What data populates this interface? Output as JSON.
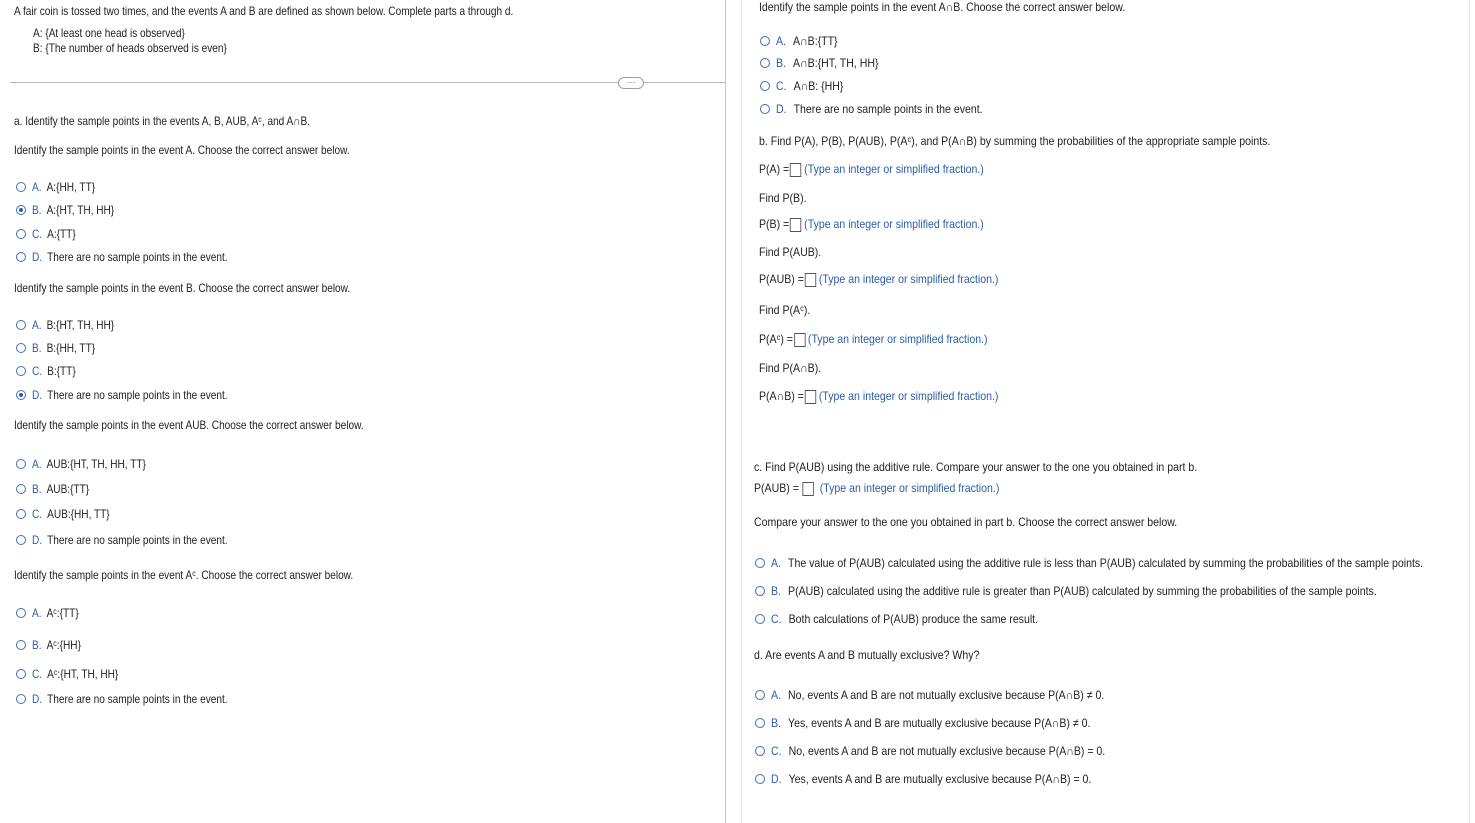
{
  "intro": {
    "text": "A fair coin is tossed two times, and the events A and B are defined as shown below. Complete parts a through d.",
    "event_a": "A: {At least one head is observed}",
    "event_b": "B: {The number of heads observed is even}"
  },
  "divider_handle": "⋯",
  "part_a": {
    "heading": "a. Identify the sample points in the events A, B, AUB, Aᶜ, and A∩B.",
    "q_a": {
      "prompt": "Identify the sample points in the event A. Choose the correct answer below.",
      "options": [
        {
          "letter": "A.",
          "text": "A:{HH, TT}",
          "selected": false
        },
        {
          "letter": "B.",
          "text": "A:{HT, TH, HH}",
          "selected": true
        },
        {
          "letter": "C.",
          "text": "A:{TT}",
          "selected": false
        },
        {
          "letter": "D.",
          "text": "There are no sample points in the event.",
          "selected": false
        }
      ]
    },
    "q_b": {
      "prompt": "Identify the sample points in the event B. Choose the correct answer below.",
      "options": [
        {
          "letter": "A.",
          "text": "B:{HT, TH, HH}",
          "selected": false
        },
        {
          "letter": "B.",
          "text": "B:{HH, TT}",
          "selected": false
        },
        {
          "letter": "C.",
          "text": "B:{TT}",
          "selected": false
        },
        {
          "letter": "D.",
          "text": "There are no sample points in the event.",
          "selected": true
        }
      ]
    },
    "q_aub": {
      "prompt": "Identify the sample points in the event AUB. Choose the correct answer below.",
      "options": [
        {
          "letter": "A.",
          "text": "AUB:{HT, TH, HH, TT}",
          "selected": false
        },
        {
          "letter": "B.",
          "text": "AUB:{TT}",
          "selected": false
        },
        {
          "letter": "C.",
          "text": "AUB:{HH, TT}",
          "selected": false
        },
        {
          "letter": "D.",
          "text": "There are no sample points in the event.",
          "selected": false
        }
      ]
    },
    "q_ac": {
      "prompt": "Identify the sample points in the event Aᶜ. Choose the correct answer below.",
      "options": [
        {
          "letter": "A.",
          "text": "Aᶜ:{TT}",
          "selected": false
        },
        {
          "letter": "B.",
          "text": "Aᶜ:{HH}",
          "selected": false
        },
        {
          "letter": "C.",
          "text": "Aᶜ:{HT, TH, HH}",
          "selected": false
        },
        {
          "letter": "D.",
          "text": "There are no sample points in the event.",
          "selected": false
        }
      ]
    }
  },
  "right": {
    "q_anb": {
      "prompt": "Identify the sample points in the event A∩B. Choose the correct answer below.",
      "options": [
        {
          "letter": "A.",
          "text": "A∩B:{TT}",
          "selected": false
        },
        {
          "letter": "B.",
          "text": "A∩B:{HT, TH, HH}",
          "selected": false
        },
        {
          "letter": "C.",
          "text": "A∩B: {HH}",
          "selected": false
        },
        {
          "letter": "D.",
          "text": "There are no sample points in the event.",
          "selected": false
        }
      ]
    },
    "part_b": {
      "heading": "b. Find P(A), P(B), P(AUB), P(Aᶜ), and P(A∩B) by summing the probabilities of the appropriate sample points.",
      "hint": "(Type an integer or simplified fraction.)",
      "items": [
        {
          "find": "",
          "label": "P(A) =",
          "value": ""
        },
        {
          "find": "Find P(B).",
          "label": "P(B) =",
          "value": ""
        },
        {
          "find": "Find P(AUB).",
          "label": "P(AUB) =",
          "value": ""
        },
        {
          "find": "Find P(Aᶜ).",
          "label": "P(Aᶜ) =",
          "value": ""
        },
        {
          "find": "Find P(A∩B).",
          "label": "P(A∩B) =",
          "value": ""
        }
      ]
    },
    "part_c": {
      "heading": "c. Find P(AUB) using the additive rule. Compare your answer to the one you obtained in part b.",
      "label": "P(AUB) =",
      "hint": "(Type an integer or simplified fraction.)",
      "compare_prompt": "Compare your answer to the one you obtained in part b. Choose the correct answer below.",
      "options": [
        {
          "letter": "A.",
          "text": "The value of P(AUB) calculated using the additive rule is less than P(AUB) calculated by summing the probabilities of the sample points.",
          "selected": false
        },
        {
          "letter": "B.",
          "text": "P(AUB) calculated using the additive rule is greater than P(AUB) calculated by summing the probabilities of the sample points.",
          "selected": false
        },
        {
          "letter": "C.",
          "text": "Both calculations of P(AUB) produce the same result.",
          "selected": false
        }
      ]
    },
    "part_d": {
      "heading": "d. Are events A and B mutually exclusive? Why?",
      "options": [
        {
          "letter": "A.",
          "text": "No, events A and B are not mutually exclusive because P(A∩B) ≠ 0.",
          "selected": false
        },
        {
          "letter": "B.",
          "text": "Yes, events A and B are mutually exclusive because P(A∩B) ≠ 0.",
          "selected": false
        },
        {
          "letter": "C.",
          "text": "No, events A and B are not mutually exclusive because P(A∩B) = 0.",
          "selected": false
        },
        {
          "letter": "D.",
          "text": "Yes, events A and B are mutually exclusive because P(A∩B) = 0.",
          "selected": false
        }
      ]
    }
  }
}
